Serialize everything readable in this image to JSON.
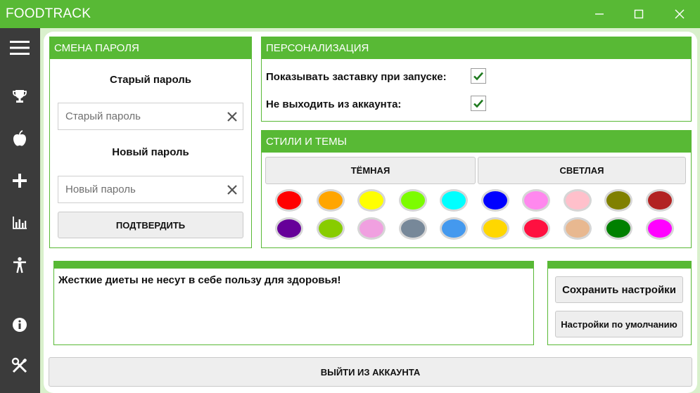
{
  "app": {
    "title": "FOODTRACK"
  },
  "sidebar": {
    "items": [
      {
        "name": "menu-icon"
      },
      {
        "name": "trophy-icon"
      },
      {
        "name": "apple-icon"
      },
      {
        "name": "plus-icon"
      },
      {
        "name": "bar-chart-icon"
      },
      {
        "name": "person-icon"
      },
      {
        "name": "info-icon"
      },
      {
        "name": "tools-icon"
      }
    ]
  },
  "password": {
    "header": "СМЕНА ПАРОЛЯ",
    "old_label": "Старый пароль",
    "old_placeholder": "Старый пароль",
    "new_label": "Новый пароль",
    "new_placeholder": "Новый пароль",
    "confirm": "ПОДТВЕРДИТЬ"
  },
  "personalization": {
    "header": "ПЕРСОНАЛИЗАЦИЯ",
    "options": [
      {
        "label": "Показывать заставку при запуске:",
        "checked": true
      },
      {
        "label": "Не выходить из аккаунта:",
        "checked": true
      }
    ]
  },
  "themes": {
    "header": "СТИЛИ И ТЕМЫ",
    "dark": "ТЁМНАЯ",
    "light": "СВЕТЛАЯ",
    "colors": [
      "#ff0000",
      "#ffa500",
      "#ffff00",
      "#7cfc00",
      "#00ffff",
      "#0000ff",
      "#ff88ee",
      "#ffc0cb",
      "#808000",
      "#b22222",
      "#660099",
      "#88cc00",
      "#f0a0e0",
      "#778899",
      "#4499ee",
      "#ffd700",
      "#ff1040",
      "#e8b890",
      "#008000",
      "#ff00ff"
    ]
  },
  "tip": {
    "text": "Жесткие диеты не несут в себе пользу для здоровья!"
  },
  "actions": {
    "save": "Сохранить настройки",
    "defaults": "Настройки по умолчанию",
    "logout": "ВЫЙТИ ИЗ АККАУНТА"
  }
}
